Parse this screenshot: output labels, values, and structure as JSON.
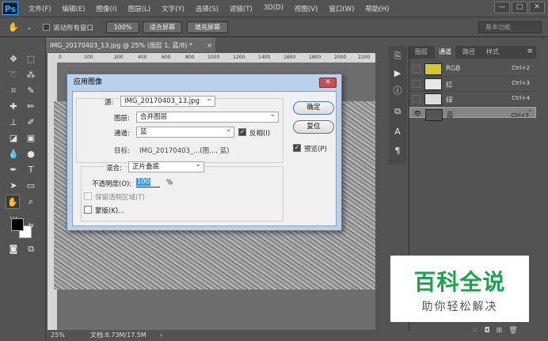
{
  "app": {
    "logo": "Ps"
  },
  "menu": [
    "文件(F)",
    "编辑(E)",
    "图像(I)",
    "图层(L)",
    "文字(Y)",
    "选择(S)",
    "滤镜(T)",
    "3D(D)",
    "视图(V)",
    "窗口(W)",
    "帮助(H)"
  ],
  "window_buttons": {
    "minimize": "—",
    "restore": "□",
    "close": "✕"
  },
  "options": {
    "scroll_all_label": "滚动所有窗口",
    "zoom_100": "100%",
    "fit_screen": "适合屏幕",
    "fill_screen": "填充屏幕",
    "workspace": "基本功能"
  },
  "document": {
    "tab_title": "IMG_20170403_13.jpg @ 25% (图层 1, 蓝/8) *",
    "tab_close": "×",
    "zoom": "25%",
    "doc_info": "文档:8.73M/17.5M"
  },
  "ruler_ticks": [
    "0",
    "100",
    "200",
    "400",
    "600",
    "800",
    "1000",
    "1200",
    "1400",
    "1600",
    "1800",
    "2000",
    "2200"
  ],
  "panel": {
    "tabs": [
      "图层",
      "通道",
      "路径",
      "样式"
    ],
    "channels": [
      {
        "name": "RGB",
        "shortcut": "Ctrl+2",
        "thumb": "#d4c82a",
        "visible": false
      },
      {
        "name": "红",
        "shortcut": "Ctrl+3",
        "thumb": "#e8e8e8",
        "visible": false
      },
      {
        "name": "绿",
        "shortcut": "Ctrl+4",
        "thumb": "#dcdcdc",
        "visible": false
      },
      {
        "name": "蓝",
        "shortcut": "Ctrl+5",
        "thumb": "#555555",
        "visible": true,
        "selected": true
      }
    ]
  },
  "dialog": {
    "title": "应用图像",
    "close": "✕",
    "source_label": "源:",
    "source_value": "IMG_20170403_13.jpg",
    "layer_label": "图层:",
    "layer_value": "合并图层",
    "channel_label": "通道:",
    "channel_value": "蓝",
    "invert_label": "反相(I)",
    "target_label": "目标:",
    "target_value": "IMG_20170403_...(图..., 蓝)",
    "blend_label": "混合:",
    "blend_value": "正片叠底",
    "opacity_label": "不透明度(O):",
    "opacity_value": "100",
    "opacity_unit": "%",
    "preserve_label": "保留透明区域(T)",
    "mask_label": "蒙版(K)...",
    "ok": "确定",
    "reset": "复位",
    "preview": "预览(P)"
  },
  "watermark": {
    "title": "百科全说",
    "subtitle": "助你轻松解决"
  },
  "colors": {
    "ui_bg": "#535353",
    "dialog_bg": "#f0f0f0",
    "dialog_frame": "#b9d1ea",
    "accent": "#1aa54a"
  }
}
